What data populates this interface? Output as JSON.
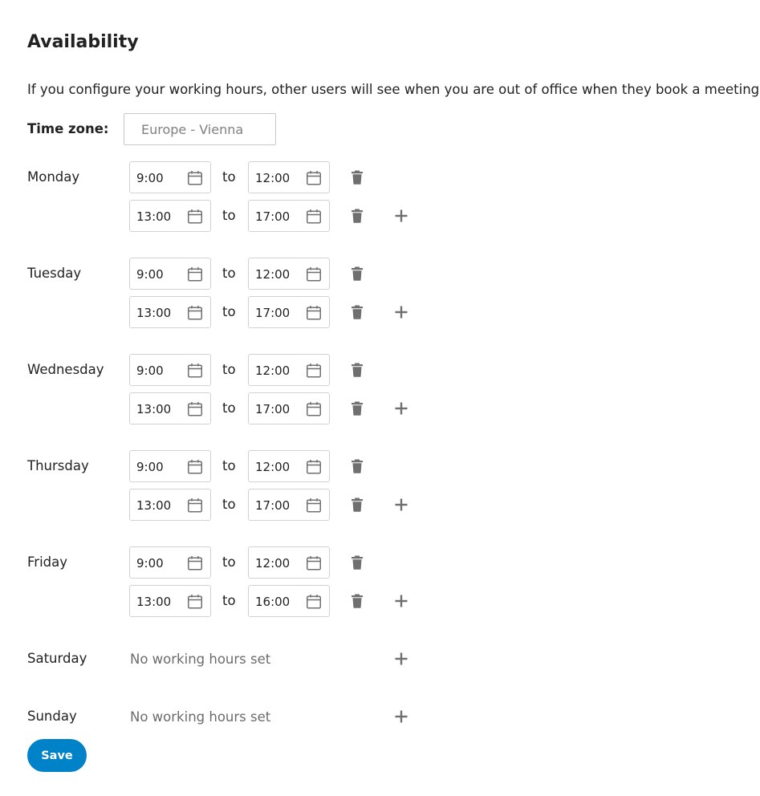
{
  "page": {
    "title": "Availability",
    "description": "If you configure your working hours, other users will see when you are out of office when they book a meeting.",
    "timezone_label": "Time zone:",
    "timezone_placeholder": "Europe - Vienna",
    "save_label": "Save"
  },
  "labels": {
    "to": "to",
    "no_hours": "No working hours set"
  },
  "days": [
    {
      "name": "Monday",
      "slots": [
        {
          "start": "9:00",
          "end": "12:00"
        },
        {
          "start": "13:00",
          "end": "17:00"
        }
      ]
    },
    {
      "name": "Tuesday",
      "slots": [
        {
          "start": "9:00",
          "end": "12:00"
        },
        {
          "start": "13:00",
          "end": "17:00"
        }
      ]
    },
    {
      "name": "Wednesday",
      "slots": [
        {
          "start": "9:00",
          "end": "12:00"
        },
        {
          "start": "13:00",
          "end": "17:00"
        }
      ]
    },
    {
      "name": "Thursday",
      "slots": [
        {
          "start": "9:00",
          "end": "12:00"
        },
        {
          "start": "13:00",
          "end": "17:00"
        }
      ]
    },
    {
      "name": "Friday",
      "slots": [
        {
          "start": "9:00",
          "end": "12:00"
        },
        {
          "start": "13:00",
          "end": "16:00"
        }
      ]
    },
    {
      "name": "Saturday",
      "slots": []
    },
    {
      "name": "Sunday",
      "slots": []
    }
  ],
  "icons": {
    "calendar": "calendar-icon",
    "delete": "trash-icon",
    "add": "plus-icon"
  },
  "colors": {
    "accent": "#0082c9",
    "icon": "#6f6f6f",
    "text": "#222222",
    "muted": "#6b6b6b"
  }
}
